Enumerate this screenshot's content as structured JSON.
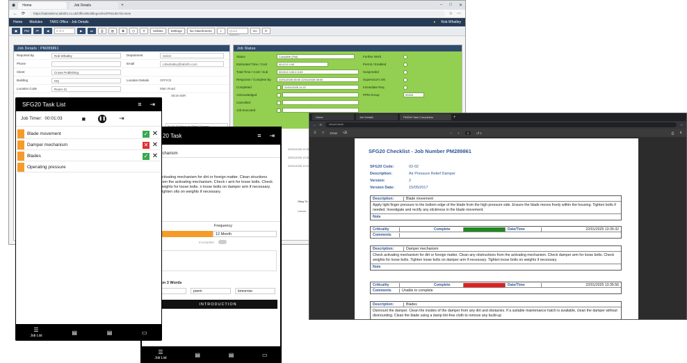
{
  "main_browser": {
    "tabs": [
      "Home",
      "Job Details"
    ],
    "url": "https://salesdemo.tabsfm.co.uk/Office/BuildingAdmin/PMJobs?id=New",
    "nav": {
      "home": "Home",
      "modules": "Modules",
      "breadcrumb": "TABS Office - Job Details",
      "user": "Rob Whatley"
    },
    "toolbar": {
      "record": "0 of 0",
      "utilities": "Utilities",
      "settings": "Settings",
      "attachments": "No Attachments",
      "search_placeholder": "Quick Search",
      "go": "Go"
    }
  },
  "job_details": {
    "title": "Job Details : PM289861",
    "rows": [
      {
        "label": "Reported By",
        "value": "Rob Whatley",
        "label2": "Department",
        "value2": "Select"
      },
      {
        "label": "Phone",
        "value": "",
        "label2": "Email",
        "value2": "robwhatley@tabsfm.com"
      },
      {
        "label": "Client",
        "value": "Crown Publishing",
        "label2": "",
        "value2": ""
      },
      {
        "label": "Building",
        "value": "HQ",
        "label2": "Location Details",
        "value2": "OFFICE"
      },
      {
        "label": "Location Code",
        "value": "Room 41",
        "label2": "",
        "value2": "Main Road"
      }
    ],
    "location_extra": "SE16 6DR",
    "asset_value": "02-02 Air Pressure Relief Damper"
  },
  "job_status": {
    "title": "Job Status",
    "left_rows": [
      {
        "label": "Status",
        "value": "Complete (Full)"
      },
      {
        "label": "Estimated Time / Cost",
        "value": "00:12  £  0.00"
      },
      {
        "label": "Total Time / Cost / Sub",
        "value": "00:00  £  0.00  £  0.00"
      },
      {
        "label": "Response / Complete By",
        "value": "22/01/2025 08:00    22/01/2025 08:00"
      },
      {
        "label": "Completed",
        "value": "22/01/2025 11:22"
      },
      {
        "label": "Acknowledged",
        "value": ""
      },
      {
        "label": "Cancelled",
        "value": ""
      },
      {
        "label": "Job Executed",
        "value": ""
      }
    ],
    "right_rows": [
      {
        "label": "Further Work",
        "value": ""
      },
      {
        "label": "Permit / Enabled",
        "value": ""
      },
      {
        "label": "Suspended",
        "value": ""
      },
      {
        "label": "Supervisor's OK",
        "value": ""
      },
      {
        "label": "Immediate Req",
        "value": ""
      },
      {
        "label": "PPM Group",
        "value": "99209"
      }
    ],
    "dates": [
      "22/01/2025 13:35",
      "22/01/2025 13:35",
      "22/01/2025 13:24"
    ],
    "side_col": "Okay To Inv",
    "side_val": "Labour"
  },
  "task_list_app": {
    "title": "SFG20 Task List",
    "timer_label": "Job Timer:",
    "timer_value": "00:01:03",
    "tasks": [
      {
        "name": "Blade movement",
        "status": "pass"
      },
      {
        "name": "Damper mechanism",
        "status": "fail"
      },
      {
        "name": "Blades",
        "status": "pass"
      },
      {
        "name": "Operating pressure",
        "status": "none"
      }
    ],
    "footer": {
      "job_list": "Job List"
    }
  },
  "task_app": {
    "title": "20 Task",
    "subtitle": "echanism",
    "description": "activating mechanism for dirt or foreign matter. Clean structions from the activating mechanism. Check r arm for loose bolts. Check weights for loose bolts. n loose bolts on damper arm if necessary. Tighten olts on weights if necessary.",
    "frequency_label": "Frequency",
    "frequency_value": "12 Month",
    "incomplete_label": "Incomplete",
    "words_label": "ion 3 Words",
    "words": [
      "poem",
      "tomorrow"
    ],
    "intro_button": "INTRODUCTION",
    "footer": {
      "job_list": "Job List"
    }
  },
  "checklist_window": {
    "tabs": [
      "Home",
      "Job Details",
      "PM289 Task Completion"
    ],
    "url": "about:blank",
    "pdf": {
      "page": "1",
      "of": "of 1",
      "zoom": "Draw"
    },
    "title": "SFG20 Checklist - Job Number PM289861",
    "meta": [
      {
        "k": "SFG20 Code:",
        "v": "02-02"
      },
      {
        "k": "Description:",
        "v": "Air Pressure Relief Damper"
      },
      {
        "k": "Version:",
        "v": "2"
      },
      {
        "k": "Version Date:",
        "v": "15/05/2017"
      }
    ],
    "items": [
      {
        "description": "Blade movement",
        "text": "Apply light finger pressure to the bottom edge of the blade from the high pressure side. Ensure the blade moves freely within the housing. Tighten bolts if needed. Investigate and rectify any stickiness in the blade movement.",
        "note": "Note",
        "criticality_label": "Criticality",
        "complete_label": "Complete",
        "complete_value": "Yes",
        "complete_color": "#1f8a1f",
        "datetime_label": "Date/Time",
        "datetime": "22/01/2025  13:35:32",
        "comments_label": "Comments",
        "comments": ""
      },
      {
        "description": "Damper mechanism",
        "text": "Check activating mechanism for dirt or foreign matter. Clean any obstructions from the activating mechanism. Check damper arm for loose bolts. Check weights for loose bolts. Tighten loose bolts on damper arm if necessary. Tighten loose bolts on weights if necessary.",
        "note": "Note",
        "criticality_label": "Criticality",
        "complete_label": "Complete",
        "complete_value": "No",
        "complete_color": "#e02020",
        "datetime_label": "Date/Time",
        "datetime": "22/01/2025  13:35:56",
        "comments_label": "Comments",
        "comments": "Unable to complete"
      },
      {
        "description": "Blades",
        "text": "Dismount the damper. Clean the insides of the damper from any dirt and obstacles. If a suitable maintenance hatch is available, clean the damper without dismounting. Clean the blade using a damp lint-free cloth to remove any build-up"
      }
    ],
    "description_label": "Description:"
  },
  "colors": {
    "navy": "#2f4a6d",
    "status_green": "#93cf50",
    "task_orange": "#f59b2a",
    "criticality_yellow": "#ffff00"
  }
}
